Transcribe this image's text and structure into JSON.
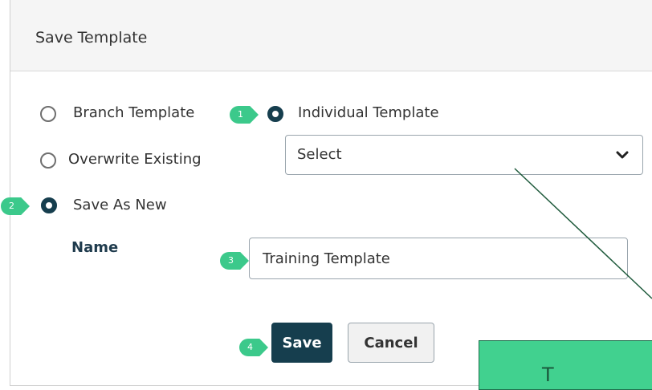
{
  "dialog": {
    "title": "Save Template",
    "options": {
      "branch_template": "Branch Template",
      "individual_template": "Individual Template",
      "overwrite_existing": "Overwrite Existing",
      "save_as_new": "Save As New"
    },
    "template_select": {
      "value": "Select"
    },
    "name": {
      "label": "Name",
      "value": "Training Template"
    },
    "buttons": {
      "save": "Save",
      "cancel": "Cancel"
    }
  },
  "callouts": [
    "1",
    "2",
    "3",
    "4"
  ],
  "annotation_box": {
    "text": "T"
  },
  "colors": {
    "primary": "#163e4e",
    "callout": "#3cc98b",
    "annotation": "#41d18f"
  },
  "icons": [
    "chevron-down-icon"
  ]
}
